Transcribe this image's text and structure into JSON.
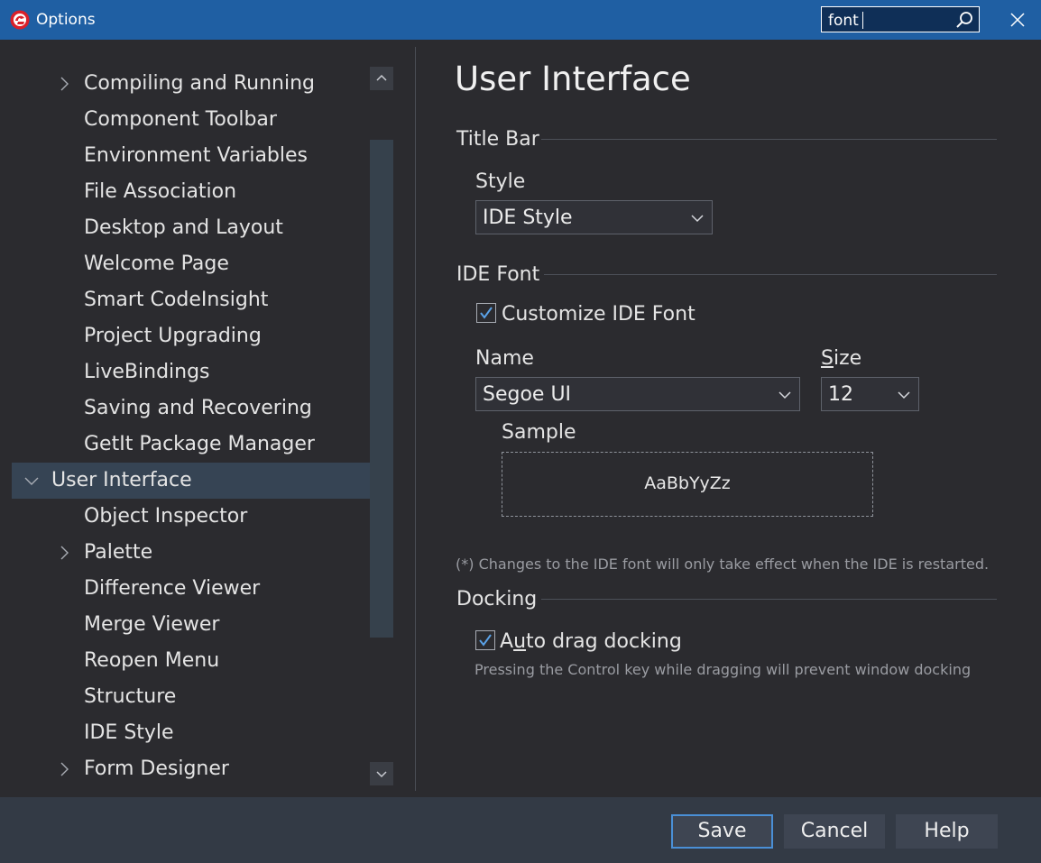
{
  "window": {
    "title": "Options",
    "search_value": "font",
    "close_icon": "close-icon",
    "app_icon": "embarcadero-logo-icon",
    "colors": {
      "titlebar": "#1f5fa3",
      "selection": "#364454",
      "default_button_border": "#4a8fd6"
    }
  },
  "tree": {
    "items": [
      {
        "label": "Compiling and Running",
        "level": 1,
        "expandable": true
      },
      {
        "label": "Component Toolbar",
        "level": 1
      },
      {
        "label": "Environment Variables",
        "level": 1
      },
      {
        "label": "File Association",
        "level": 1
      },
      {
        "label": "Desktop and Layout",
        "level": 1
      },
      {
        "label": "Welcome Page",
        "level": 1
      },
      {
        "label": "Smart CodeInsight",
        "level": 1
      },
      {
        "label": "Project Upgrading",
        "level": 1
      },
      {
        "label": "LiveBindings",
        "level": 1
      },
      {
        "label": "Saving and Recovering",
        "level": 1
      },
      {
        "label": "GetIt Package Manager",
        "level": 1
      },
      {
        "label": "User Interface",
        "level": 0,
        "expanded": true,
        "selected": true
      },
      {
        "label": "Object Inspector",
        "level": 1
      },
      {
        "label": "Palette",
        "level": 1,
        "expandable": true
      },
      {
        "label": "Difference Viewer",
        "level": 1
      },
      {
        "label": "Merge Viewer",
        "level": 1
      },
      {
        "label": "Reopen Menu",
        "level": 1
      },
      {
        "label": "Structure",
        "level": 1
      },
      {
        "label": "IDE Style",
        "level": 1
      },
      {
        "label": "Form Designer",
        "level": 1,
        "expandable": true
      }
    ]
  },
  "page": {
    "title": "User Interface",
    "title_bar": {
      "group_label": "Title Bar",
      "style_label": "Style",
      "style_value": "IDE Style"
    },
    "ide_font": {
      "group_label": "IDE Font",
      "customize_label": "Customize IDE Font",
      "customize_checked": true,
      "name_label": "Name",
      "name_value": "Segoe UI",
      "size_label_u": "S",
      "size_label_rest": "ize",
      "size_value": "12",
      "sample_label": "Sample",
      "sample_text": "AaBbYyZz",
      "note": "(*) Changes to the IDE font will only take effect when the IDE is restarted."
    },
    "docking": {
      "group_label": "Docking",
      "auto_drag_label_a": "A",
      "auto_drag_label_u": "u",
      "auto_drag_label_rest": "to drag docking",
      "auto_drag_checked": true,
      "hint": "Pressing the Control key while dragging will prevent window docking"
    }
  },
  "footer": {
    "save_label": "Save",
    "cancel_label": "Cancel",
    "help_label": "Help"
  }
}
